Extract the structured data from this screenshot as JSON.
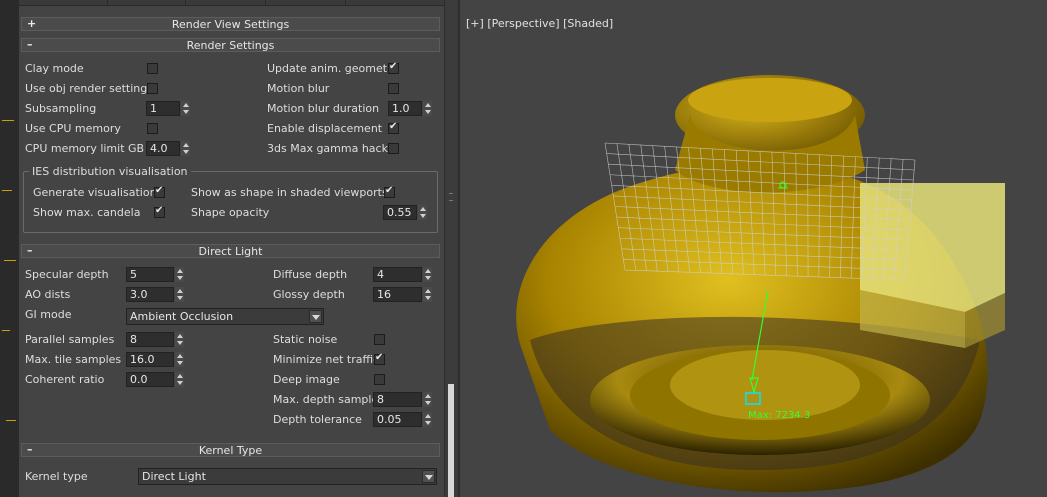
{
  "render_view_settings": {
    "sign": "+",
    "title": "Render View Settings"
  },
  "render_settings": {
    "sign": "–",
    "title": "Render Settings",
    "clay_mode": "Clay mode",
    "use_obj_render_settings": "Use obj render settings",
    "subsampling": "Subsampling",
    "subsampling_value": "1",
    "use_cpu_memory": "Use CPU memory",
    "cpu_memory_limit": "CPU memory limit GB",
    "cpu_memory_limit_value": "4.0",
    "update_anim_geometry": "Update anim. geometry",
    "motion_blur": "Motion blur",
    "motion_blur_duration": "Motion blur duration",
    "motion_blur_duration_value": "1.0",
    "enable_displacement": "Enable displacement",
    "gamma_hack": "3ds Max gamma hack",
    "checks": {
      "clay_mode": false,
      "use_obj_render_settings": false,
      "use_cpu_memory": false,
      "update_anim_geometry": true,
      "motion_blur": false,
      "enable_displacement": true,
      "gamma_hack": false
    }
  },
  "ies": {
    "legend": "IES distribution visualisation",
    "generate_visualisation": "Generate visualisation",
    "show_max_candela": "Show max. candela",
    "show_as_shape": "Show as shape in shaded viewports",
    "shape_opacity": "Shape opacity",
    "shape_opacity_value": "0.55",
    "checks": {
      "generate_visualisation": true,
      "show_max_candela": true,
      "show_as_shape": true
    }
  },
  "direct_light": {
    "sign": "–",
    "title": "Direct Light",
    "specular_depth": "Specular depth",
    "specular_depth_value": "5",
    "ao_dists": "AO dists",
    "ao_dists_value": "3.0",
    "gi_mode": "GI mode",
    "gi_mode_value": "Ambient Occlusion",
    "parallel_samples": "Parallel samples",
    "parallel_samples_value": "8",
    "max_tile_samples": "Max. tile samples",
    "max_tile_samples_value": "16.0",
    "coherent_ratio": "Coherent ratio",
    "coherent_ratio_value": "0.0",
    "diffuse_depth": "Diffuse depth",
    "diffuse_depth_value": "4",
    "glossy_depth": "Glossy depth",
    "glossy_depth_value": "16",
    "static_noise": "Static noise",
    "minimize_net_traffic": "Minimize net traffic",
    "deep_image": "Deep image",
    "max_depth_samples": "Max. depth samples",
    "max_depth_samples_value": "8",
    "depth_tolerance": "Depth tolerance",
    "depth_tolerance_value": "0.05",
    "checks": {
      "static_noise": false,
      "minimize_net_traffic": true,
      "deep_image": false
    }
  },
  "kernel_type": {
    "sign": "–",
    "title": "Kernel Type",
    "label": "Kernel type",
    "value": "Direct Light"
  },
  "viewport": {
    "plus": "[+]",
    "view": "[Perspective]",
    "shading": "[Shaded]",
    "max_candela_text": "Max: 7234.3",
    "colors": {
      "object": "#b08a00",
      "light_box": "#e6e27a",
      "gizmo": "#33ff33",
      "ies_grid": "#d0d0d0",
      "target": "#00e5ff"
    }
  }
}
